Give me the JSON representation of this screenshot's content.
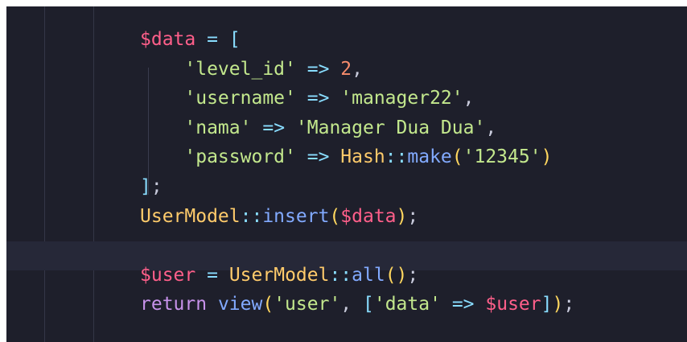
{
  "editor": {
    "lines": [
      [
        {
          "t": "$data",
          "c": "var"
        },
        {
          "t": " ",
          "c": "plain"
        },
        {
          "t": "=",
          "c": "op"
        },
        {
          "t": " ",
          "c": "plain"
        },
        {
          "t": "[",
          "c": "op"
        }
      ],
      [
        {
          "t": "    ",
          "c": "plain"
        },
        {
          "t": "'level_id'",
          "c": "str"
        },
        {
          "t": " ",
          "c": "plain"
        },
        {
          "t": "=>",
          "c": "op"
        },
        {
          "t": " ",
          "c": "plain"
        },
        {
          "t": "2",
          "c": "num"
        },
        {
          "t": ",",
          "c": "plain"
        }
      ],
      [
        {
          "t": "    ",
          "c": "plain"
        },
        {
          "t": "'username'",
          "c": "str"
        },
        {
          "t": " ",
          "c": "plain"
        },
        {
          "t": "=>",
          "c": "op"
        },
        {
          "t": " ",
          "c": "plain"
        },
        {
          "t": "'manager22'",
          "c": "str"
        },
        {
          "t": ",",
          "c": "plain"
        }
      ],
      [
        {
          "t": "    ",
          "c": "plain"
        },
        {
          "t": "'nama'",
          "c": "str"
        },
        {
          "t": " ",
          "c": "plain"
        },
        {
          "t": "=>",
          "c": "op"
        },
        {
          "t": " ",
          "c": "plain"
        },
        {
          "t": "'Manager Dua Dua'",
          "c": "str"
        },
        {
          "t": ",",
          "c": "plain"
        }
      ],
      [
        {
          "t": "    ",
          "c": "plain"
        },
        {
          "t": "'password'",
          "c": "str"
        },
        {
          "t": " ",
          "c": "plain"
        },
        {
          "t": "=>",
          "c": "op"
        },
        {
          "t": " ",
          "c": "plain"
        },
        {
          "t": "Hash",
          "c": "cls"
        },
        {
          "t": "::",
          "c": "op"
        },
        {
          "t": "make",
          "c": "fn"
        },
        {
          "t": "(",
          "c": "br"
        },
        {
          "t": "'12345'",
          "c": "str"
        },
        {
          "t": ")",
          "c": "br"
        }
      ],
      [
        {
          "t": "]",
          "c": "op"
        },
        {
          "t": ";",
          "c": "plain"
        }
      ],
      [
        {
          "t": "UserModel",
          "c": "cls"
        },
        {
          "t": "::",
          "c": "op"
        },
        {
          "t": "insert",
          "c": "fn"
        },
        {
          "t": "(",
          "c": "br"
        },
        {
          "t": "$data",
          "c": "var"
        },
        {
          "t": ")",
          "c": "br"
        },
        {
          "t": ";",
          "c": "plain"
        }
      ],
      [],
      [
        {
          "t": "$user",
          "c": "var"
        },
        {
          "t": " ",
          "c": "plain"
        },
        {
          "t": "=",
          "c": "op"
        },
        {
          "t": " ",
          "c": "plain"
        },
        {
          "t": "UserModel",
          "c": "cls"
        },
        {
          "t": "::",
          "c": "op"
        },
        {
          "t": "all",
          "c": "fn"
        },
        {
          "t": "()",
          "c": "br"
        },
        {
          "t": ";",
          "c": "plain"
        }
      ],
      [
        {
          "t": "return",
          "c": "kw"
        },
        {
          "t": " ",
          "c": "plain"
        },
        {
          "t": "view",
          "c": "fn"
        },
        {
          "t": "(",
          "c": "br"
        },
        {
          "t": "'user'",
          "c": "str"
        },
        {
          "t": ", ",
          "c": "plain"
        },
        {
          "t": "[",
          "c": "op"
        },
        {
          "t": "'data'",
          "c": "str"
        },
        {
          "t": " ",
          "c": "plain"
        },
        {
          "t": "=>",
          "c": "op"
        },
        {
          "t": " ",
          "c": "plain"
        },
        {
          "t": "$user",
          "c": "var"
        },
        {
          "t": "]",
          "c": "op"
        },
        {
          "t": ")",
          "c": "br"
        },
        {
          "t": ";",
          "c": "plain"
        }
      ]
    ]
  }
}
